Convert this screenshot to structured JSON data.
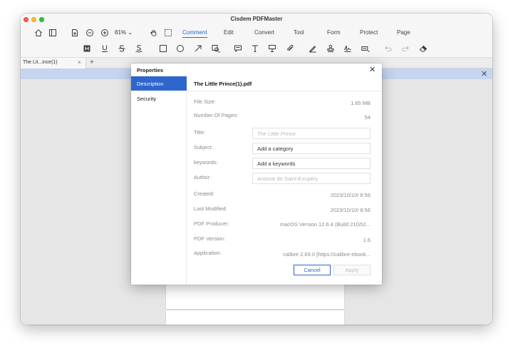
{
  "app": {
    "title": "Cisdem PDFMaster"
  },
  "toolbar": {
    "zoom": "81%",
    "tabs": [
      "Comment",
      "Edit",
      "Convert",
      "Tool",
      "Form",
      "Protect",
      "Page"
    ],
    "active_tab": "Comment"
  },
  "annotation_tools": [
    "highlight-icon",
    "underline-icon",
    "strikethrough-icon",
    "squiggly-icon",
    "rectangle-icon",
    "ellipse-icon",
    "arrow-icon",
    "shape-menu-icon",
    "note-icon",
    "text-icon",
    "callout-icon",
    "attachment-icon",
    "pen-icon",
    "stamp-icon",
    "signature-icon",
    "textbox-menu-icon",
    "undo-icon",
    "redo-icon",
    "eraser-icon"
  ],
  "document_tab": {
    "label": "The Lit...ince(1)",
    "close": "×",
    "new": "+"
  },
  "infobar": {
    "close": "✕"
  },
  "dialog": {
    "title": "Properties",
    "close": "✕",
    "sidebar": [
      "Description",
      "Security"
    ],
    "active_sidebar": "Description",
    "filename": "The Little Prince(1).pdf",
    "file_size_label": "File Size:",
    "file_size": "1.65 MB",
    "pages_label": "Number Of Pages:",
    "pages": "54",
    "title_label": "Title:",
    "title_value": "The Little Prince",
    "subject_label": "Subject:",
    "subject_value": "Add a category",
    "keywords_label": "keywords:",
    "keywords_value": "Add a keywords",
    "author_label": "Author:",
    "author_value": "Antoine de Saint-Exupéry",
    "created_label": "Created:",
    "created": "2023/10/10/ 8:56",
    "modified_label": "Last Modified:",
    "modified": "2023/10/10/ 8:56",
    "producer_label": "PDF Producer:",
    "producer": "macOS Version 12.6.4 (Build 21G52...",
    "version_label": "PDF Version:",
    "version": "1.6",
    "application_label": "Application:",
    "application": "calibre 2.69.0 [https://calibre-ebook...",
    "cancel": "Cancel",
    "apply": "Apply"
  }
}
